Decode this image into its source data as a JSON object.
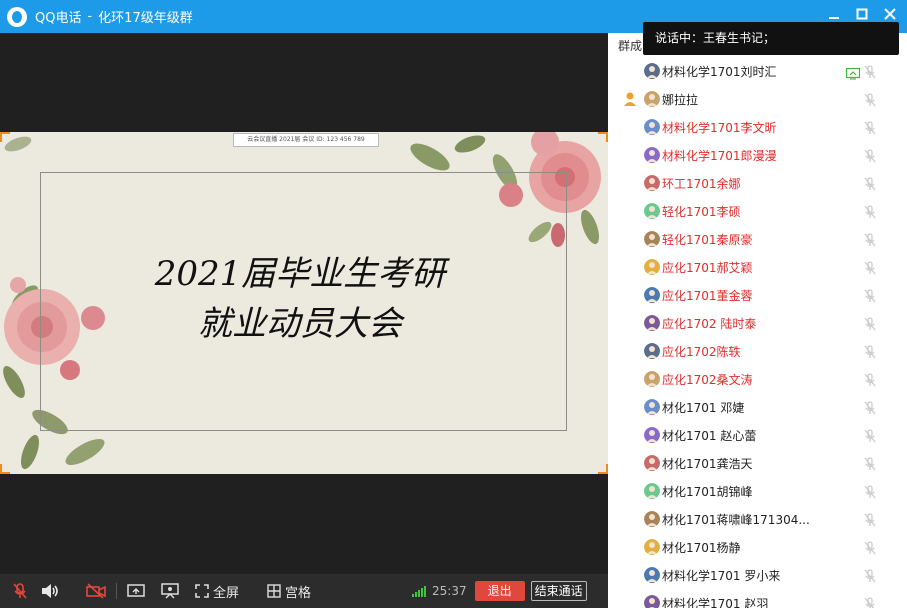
{
  "window": {
    "app_name": "QQ电话",
    "separator": "-",
    "group_name": "化环17级年级群",
    "min_icon": "minimize-icon",
    "max_icon": "maximize-icon",
    "close_icon": "close-icon"
  },
  "slide": {
    "caption": "云会议直播  2021届  会议 ID: 123 456 789",
    "title_line1": "2021届毕业生考研",
    "title_line2": "就业动员大会"
  },
  "toolbar": {
    "mic_icon": "mic-muted-icon",
    "speaker_icon": "speaker-icon",
    "camera_icon": "camera-off-icon",
    "screen_share_icon": "screen-share-icon",
    "present_icon": "present-icon",
    "fullscreen_label": "全屏",
    "grid_label": "宫格",
    "timer": "25:37",
    "exit_label": "退出",
    "end_call_label": "结束通话"
  },
  "panel": {
    "header": "群成",
    "speaking_label": "说话中：王春生书记；"
  },
  "members": [
    {
      "name": "材料化学1701刘时汇",
      "red": false,
      "host": false,
      "sharing": true
    },
    {
      "name": "娜拉拉",
      "red": false,
      "host": true,
      "sharing": false
    },
    {
      "name": "材料化学1701李文昕",
      "red": true,
      "host": false,
      "sharing": false
    },
    {
      "name": "材料化学1701郎漫漫",
      "red": true,
      "host": false,
      "sharing": false
    },
    {
      "name": "环工1701余娜",
      "red": true,
      "host": false,
      "sharing": false
    },
    {
      "name": "轻化1701李硕",
      "red": true,
      "host": false,
      "sharing": false
    },
    {
      "name": "轻化1701秦原豪",
      "red": true,
      "host": false,
      "sharing": false
    },
    {
      "name": "应化1701郝艾颖",
      "red": true,
      "host": false,
      "sharing": false
    },
    {
      "name": "应化1701董金蓉",
      "red": true,
      "host": false,
      "sharing": false
    },
    {
      "name": "应化1702 陆时泰",
      "red": true,
      "host": false,
      "sharing": false
    },
    {
      "name": "应化1702陈轶",
      "red": true,
      "host": false,
      "sharing": false
    },
    {
      "name": "应化1702桑文涛",
      "red": true,
      "host": false,
      "sharing": false
    },
    {
      "name": "材化1701  邓婕",
      "red": false,
      "host": false,
      "sharing": false
    },
    {
      "name": "材化1701  赵心蕾",
      "red": false,
      "host": false,
      "sharing": false
    },
    {
      "name": "材化1701龚浩天",
      "red": false,
      "host": false,
      "sharing": false
    },
    {
      "name": "材化1701胡锦峰",
      "red": false,
      "host": false,
      "sharing": false
    },
    {
      "name": "材化1701蒋啸峰171304...",
      "red": false,
      "host": false,
      "sharing": false
    },
    {
      "name": "材化1701杨静",
      "red": false,
      "host": false,
      "sharing": false
    },
    {
      "name": "材料化学1701 罗小来",
      "red": false,
      "host": false,
      "sharing": false
    },
    {
      "name": "材料化学1701 赵羽",
      "red": false,
      "host": false,
      "sharing": false
    }
  ],
  "colors": {
    "titlebar": "#1e9be8",
    "accent_red": "#e52b2b",
    "exit_button": "#e0483e",
    "frame_corner": "#f08a1c"
  }
}
